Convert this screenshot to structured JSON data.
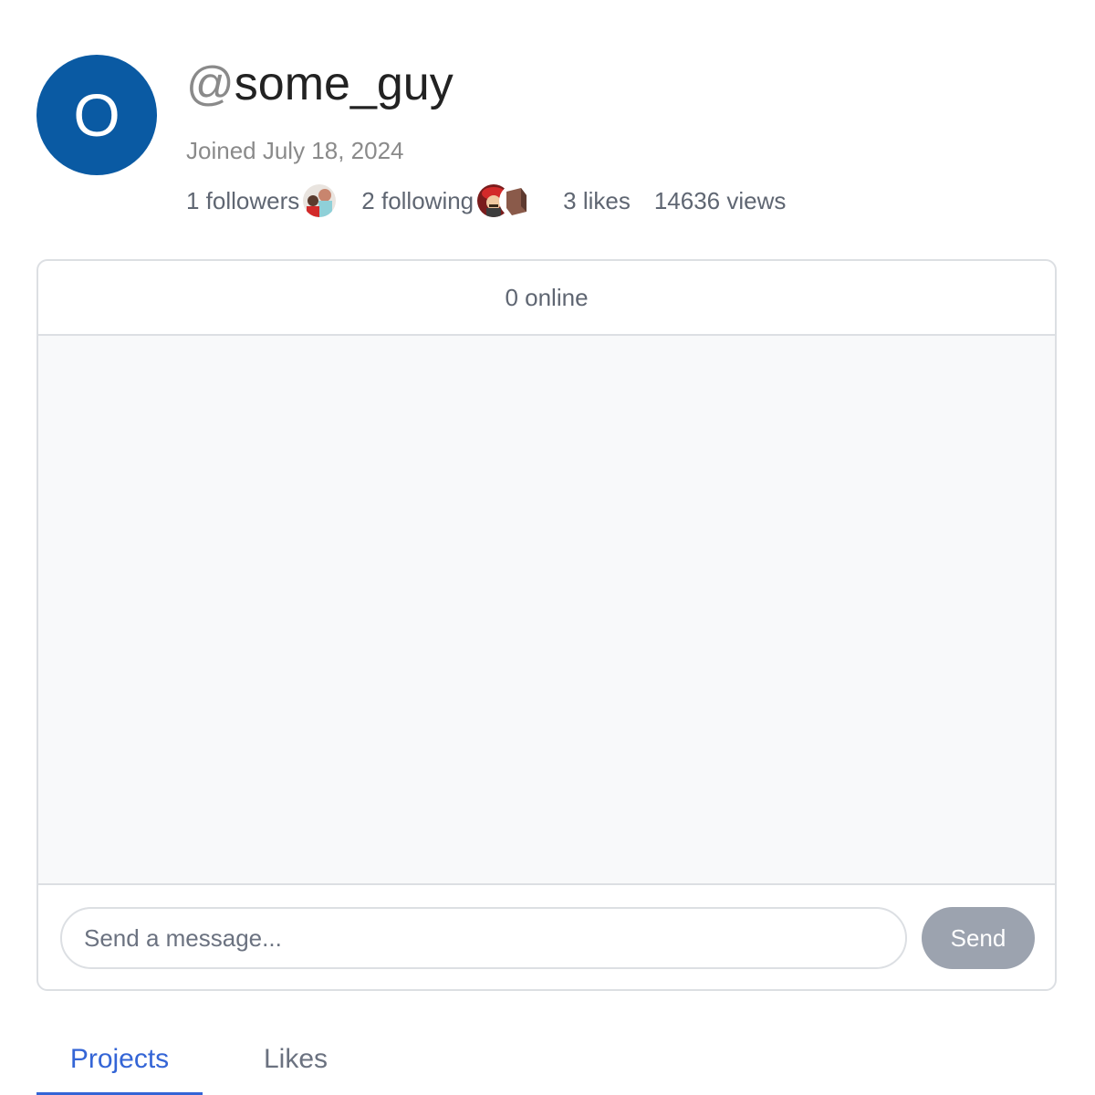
{
  "profile": {
    "avatar_initial": "O",
    "username_at": "@",
    "username": "some_guy",
    "joined": "Joined July 18, 2024"
  },
  "stats": {
    "followers": "1 followers",
    "following": "2 following",
    "likes": "3 likes",
    "views": "14636 views"
  },
  "chat": {
    "online": "0 online",
    "input_placeholder": "Send a message...",
    "input_value": "",
    "send_label": "Send"
  },
  "tabs": [
    {
      "label": "Projects",
      "active": true
    },
    {
      "label": "Likes",
      "active": false
    }
  ],
  "colors": {
    "avatar_bg": "#0a5aa3",
    "active_tab": "#3465d6",
    "send_button_bg": "#9ca3af",
    "chat_body_bg": "#f8f9fa"
  }
}
